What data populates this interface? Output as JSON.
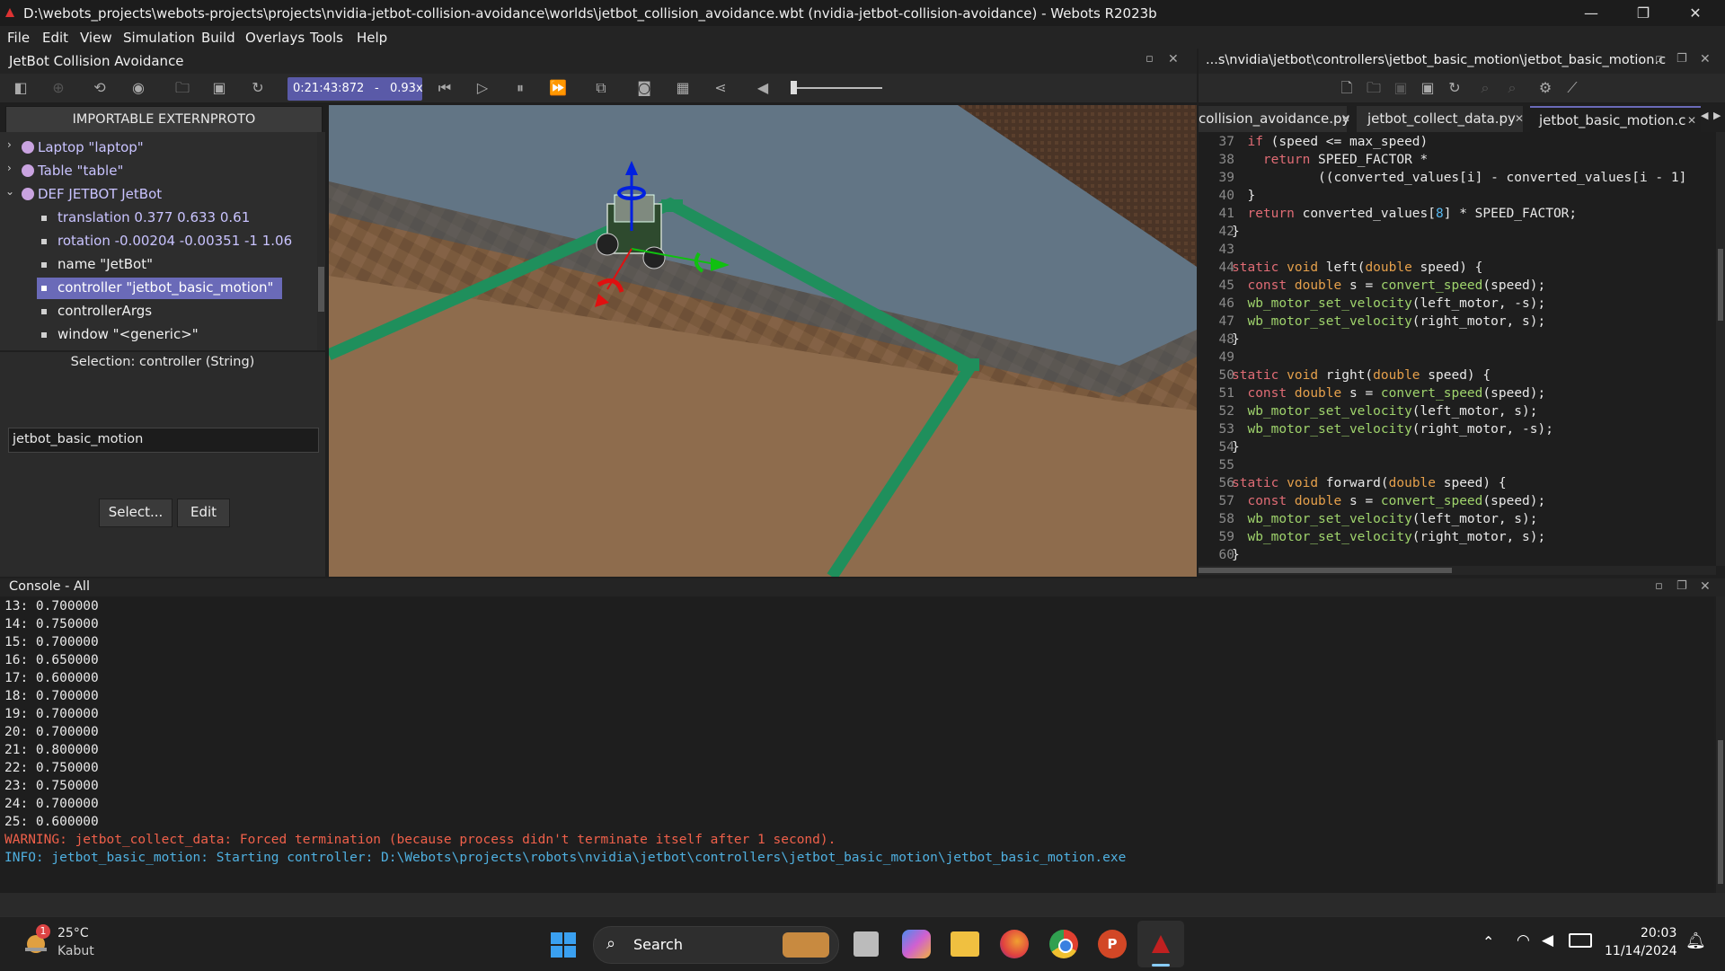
{
  "window": {
    "title": "D:\\webots_projects\\webots-projects\\projects\\nvidia-jetbot-collision-avoidance\\worlds\\jetbot_collision_avoidance.wbt (nvidia-jetbot-collision-avoidance) - Webots R2023b"
  },
  "menu": [
    "File",
    "Edit",
    "View",
    "Simulation",
    "Build",
    "Overlays",
    "Tools",
    "Help"
  ],
  "world_panel": {
    "title": "JetBot Collision Avoidance"
  },
  "toolbar": {
    "time": "0:21:43:872",
    "separator": "-",
    "speed": "0.93x"
  },
  "scene_tree": {
    "header": "IMPORTABLE EXTERNPROTO",
    "rows": [
      {
        "label": "Laptop \"laptop\""
      },
      {
        "label": "Table \"table\""
      },
      {
        "label": "DEF JETBOT JetBot"
      },
      {
        "label": "translation 0.377 0.633 0.61"
      },
      {
        "label": "rotation -0.00204 -0.00351 -1 1.06"
      },
      {
        "label": "name \"JetBot\""
      },
      {
        "label": "controller \"jetbot_basic_motion\""
      },
      {
        "label": "controllerArgs"
      },
      {
        "label": "window \"<generic>\""
      }
    ]
  },
  "field_editor": {
    "selection": "Selection: controller (String)",
    "value": "jetbot_basic_motion",
    "select_button": "Select...",
    "edit_button": "Edit"
  },
  "editor": {
    "path": "...s\\nvidia\\jetbot\\controllers\\jetbot_basic_motion\\jetbot_basic_motion.c",
    "tabs": [
      {
        "label": "collision_avoidance.py",
        "close": "✕"
      },
      {
        "label": "jetbot_collect_data.py",
        "close": "✕"
      },
      {
        "label": "jetbot_basic_motion.c",
        "close": "✕"
      }
    ],
    "lines": [
      {
        "n": "37",
        "t": "  if (speed <= max_speed)"
      },
      {
        "n": "38",
        "t": "    return SPEED_FACTOR *"
      },
      {
        "n": "39",
        "t": "           ((converted_values[i] - converted_values[i - 1]"
      },
      {
        "n": "40",
        "t": "  }"
      },
      {
        "n": "41",
        "t": "  return converted_values[8] * SPEED_FACTOR;"
      },
      {
        "n": "42",
        "t": "}"
      },
      {
        "n": "43",
        "t": ""
      },
      {
        "n": "44",
        "t": "static void left(double speed) {"
      },
      {
        "n": "45",
        "t": "  const double s = convert_speed(speed);"
      },
      {
        "n": "46",
        "t": "  wb_motor_set_velocity(left_motor, -s);"
      },
      {
        "n": "47",
        "t": "  wb_motor_set_velocity(right_motor, s);"
      },
      {
        "n": "48",
        "t": "}"
      },
      {
        "n": "49",
        "t": ""
      },
      {
        "n": "50",
        "t": "static void right(double speed) {"
      },
      {
        "n": "51",
        "t": "  const double s = convert_speed(speed);"
      },
      {
        "n": "52",
        "t": "  wb_motor_set_velocity(left_motor, s);"
      },
      {
        "n": "53",
        "t": "  wb_motor_set_velocity(right_motor, -s);"
      },
      {
        "n": "54",
        "t": "}"
      },
      {
        "n": "55",
        "t": ""
      },
      {
        "n": "56",
        "t": "static void forward(double speed) {"
      },
      {
        "n": "57",
        "t": "  const double s = convert_speed(speed);"
      },
      {
        "n": "58",
        "t": "  wb_motor_set_velocity(left_motor, s);"
      },
      {
        "n": "59",
        "t": "  wb_motor_set_velocity(right_motor, s);"
      },
      {
        "n": "60",
        "t": "}"
      }
    ]
  },
  "console": {
    "title": "Console - All",
    "lines": [
      "13: 0.700000",
      "14: 0.750000",
      "15: 0.700000",
      "16: 0.650000",
      "17: 0.600000",
      "18: 0.700000",
      "19: 0.700000",
      "20: 0.700000",
      "21: 0.800000",
      "22: 0.750000",
      "23: 0.750000",
      "24: 0.700000",
      "25: 0.600000"
    ],
    "warning": "WARNING: jetbot_collect_data: Forced termination (because process didn't terminate itself after 1 second).",
    "info": "INFO: jetbot_basic_motion: Starting controller: D:\\Webots\\projects\\robots\\nvidia\\jetbot\\controllers\\jetbot_basic_motion\\jetbot_basic_motion.exe"
  },
  "taskbar": {
    "weather_temp": "25°C",
    "weather_desc": "Kabut",
    "weather_badge": "1",
    "search": "Search",
    "time": "20:03",
    "date": "11/14/2024"
  },
  "colors": {
    "warning": "#f0604a",
    "info": "#4fb0e0",
    "selection": "#6a6ab8",
    "tree_bullet": "#c9a3e0"
  }
}
